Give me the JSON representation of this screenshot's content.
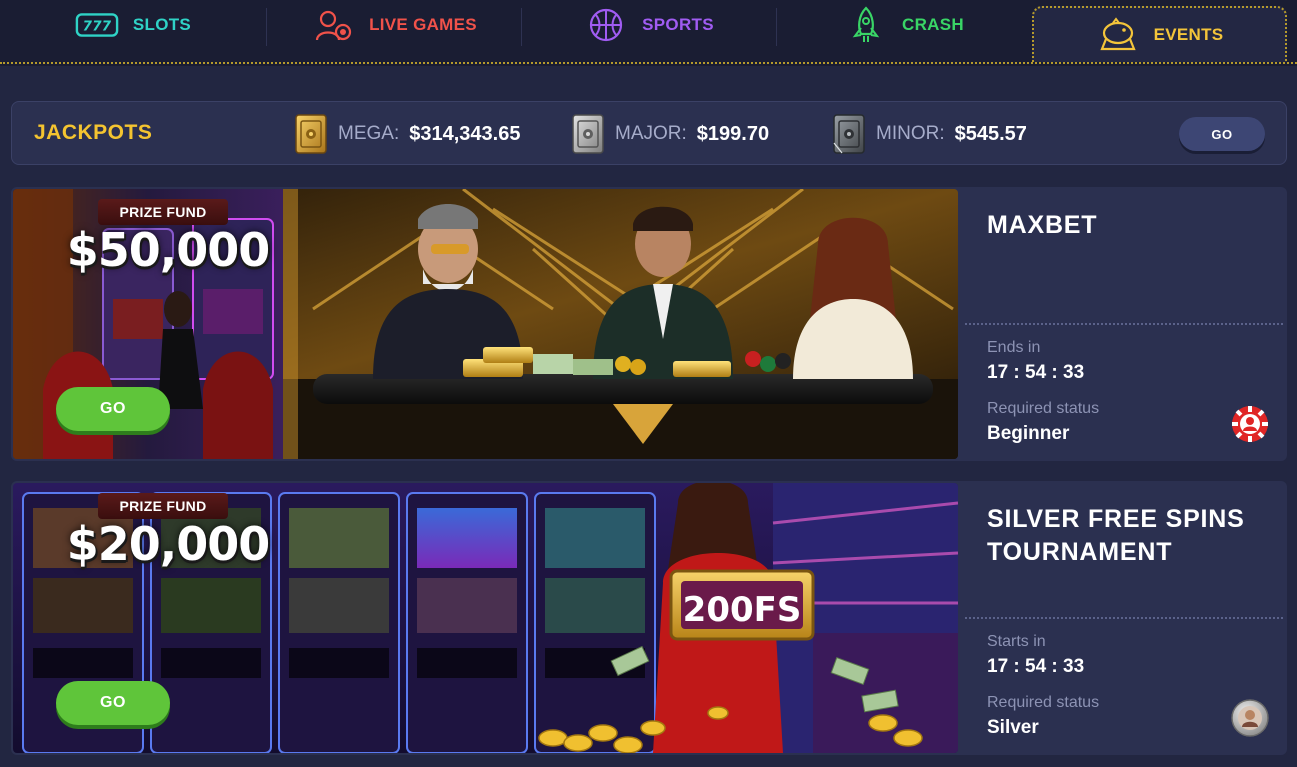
{
  "nav": {
    "tabs": [
      {
        "label": "SLOTS",
        "icon": "slot-machine-icon",
        "color": "#2fd3c6"
      },
      {
        "label": "LIVE GAMES",
        "icon": "live-dealer-icon",
        "color": "#f0524a"
      },
      {
        "label": "SPORTS",
        "icon": "basketball-icon",
        "color": "#a05cf2"
      },
      {
        "label": "CRASH",
        "icon": "rocket-icon",
        "color": "#39d566"
      },
      {
        "label": "EVENTS",
        "icon": "piggy-bank-icon",
        "color": "#f3c43a",
        "active": true
      }
    ]
  },
  "jackpots": {
    "title": "JACKPOTS",
    "items": [
      {
        "label": "MEGA:",
        "value": "$314,343.65",
        "icon": "gold-safe-icon"
      },
      {
        "label": "MAJOR:",
        "value": "$199.70",
        "icon": "silver-safe-icon"
      },
      {
        "label": "MINOR:",
        "value": "$545.57",
        "icon": "iron-safe-icon"
      }
    ],
    "go_label": "GO"
  },
  "events": [
    {
      "title": "MAXBET",
      "prize_label": "PRIZE FUND",
      "prize_amount": "$50,000",
      "go_label": "GO",
      "time_label": "Ends in",
      "time_value": "17 : 54 : 33",
      "status_label": "Required status",
      "status_value": "Beginner",
      "status_icon": "red-chip-badge-icon"
    },
    {
      "title": "SILVER FREE SPINS TOURNAMENT",
      "prize_label": "PRIZE FUND",
      "prize_amount": "$20,000",
      "banner_sign": "200FS",
      "go_label": "GO",
      "time_label": "Starts in",
      "time_value": "17 : 54 : 33",
      "status_label": "Required status",
      "status_value": "Silver",
      "status_icon": "silver-avatar-badge-icon"
    }
  ]
}
